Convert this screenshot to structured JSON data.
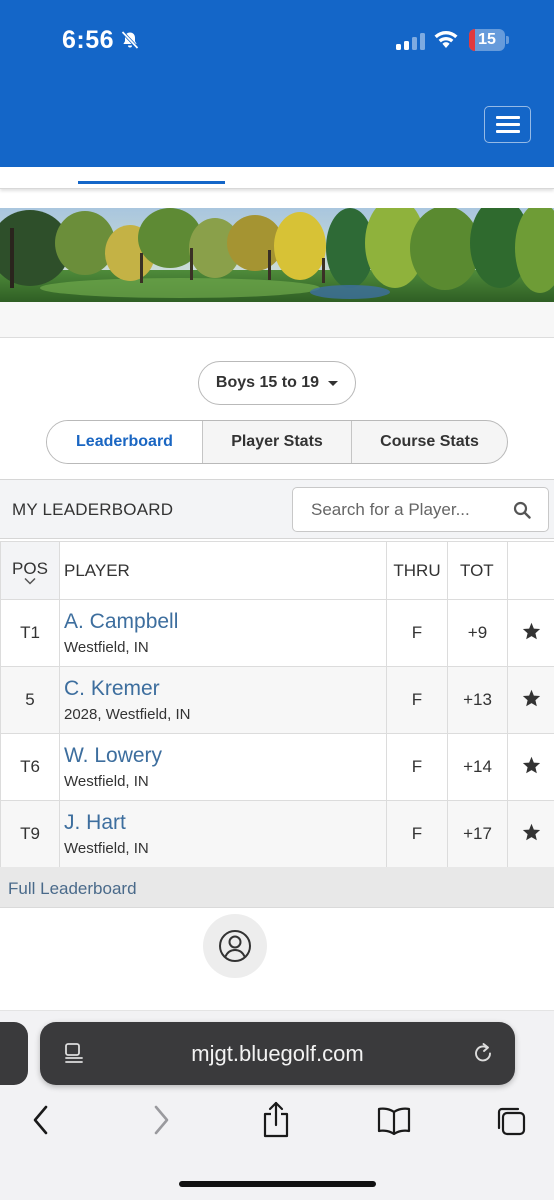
{
  "status_bar": {
    "time": "6:56",
    "battery": "15"
  },
  "division_select": {
    "label": "Boys 15 to 19"
  },
  "view_tabs": [
    {
      "label": "Leaderboard"
    },
    {
      "label": "Player Stats"
    },
    {
      "label": "Course Stats"
    }
  ],
  "my_leaderboard": {
    "title": "MY LEADERBOARD",
    "search_placeholder": "Search for a Player..."
  },
  "table": {
    "headers": {
      "pos": "POS",
      "player": "PLAYER",
      "thru": "THRU",
      "tot": "TOT"
    },
    "rows": [
      {
        "pos": "T1",
        "name": "A. Campbell",
        "location": "Westfield, IN",
        "thru": "F",
        "tot": "+9"
      },
      {
        "pos": "5",
        "name": "C. Kremer",
        "location": "2028, Westfield, IN",
        "thru": "F",
        "tot": "+13"
      },
      {
        "pos": "T6",
        "name": "W. Lowery",
        "location": "Westfield, IN",
        "thru": "F",
        "tot": "+14"
      },
      {
        "pos": "T9",
        "name": "J. Hart",
        "location": "Westfield, IN",
        "thru": "F",
        "tot": "+17"
      }
    ]
  },
  "full_leaderboard_link": "Full Leaderboard",
  "browser": {
    "url": "mjgt.bluegolf.com"
  },
  "colors": {
    "header_blue": "#1466c8",
    "link_blue": "#3d6e9e",
    "active_tab": "#1a66c2"
  },
  "icons": [
    "bell-slash-icon",
    "cellular-signal-icon",
    "wifi-icon",
    "battery-icon",
    "hamburger-menu-icon",
    "chevron-down-icon",
    "search-icon",
    "star-icon",
    "user-icon",
    "tabs-icon",
    "reload-icon",
    "back-icon",
    "forward-icon",
    "share-icon",
    "bookmarks-icon",
    "tab-overview-icon"
  ]
}
